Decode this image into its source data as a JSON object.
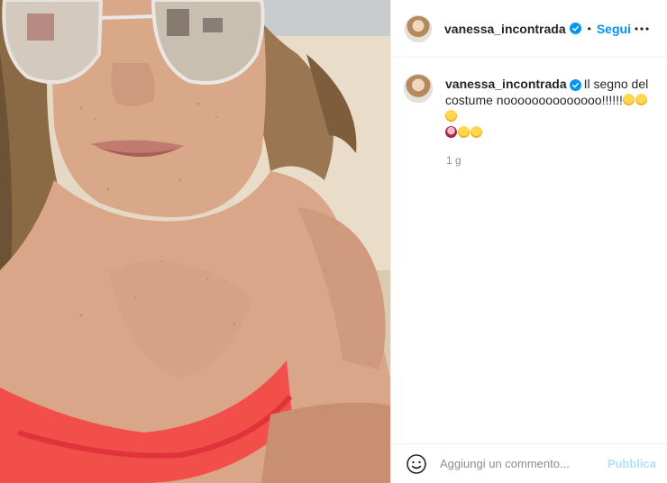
{
  "post": {
    "author": {
      "username": "vanessa_incontrada",
      "verified": true
    },
    "header": {
      "separator": "•",
      "follow_label": "Segui"
    },
    "caption": {
      "text": "Il segno del costume noooooooooooooo!!!!!!",
      "emojis": [
        "face-with-tears-of-joy",
        "face-with-tears-of-joy",
        "face-with-tears-of-joy",
        "face-with-hand-over-mouth",
        "face-with-tears-of-joy",
        "face-with-tears-of-joy"
      ]
    },
    "timestamp": "1 g",
    "composer": {
      "placeholder": "Aggiungi un commento...",
      "publish_label": "Pubblica"
    },
    "photo": {
      "subject": "beach selfie with sunglasses and red bikini"
    }
  },
  "colors": {
    "accent": "#0095f6",
    "publish_disabled": "#b2dffc",
    "text": "#262626",
    "muted": "#8e8e8e",
    "border": "#efefef"
  }
}
